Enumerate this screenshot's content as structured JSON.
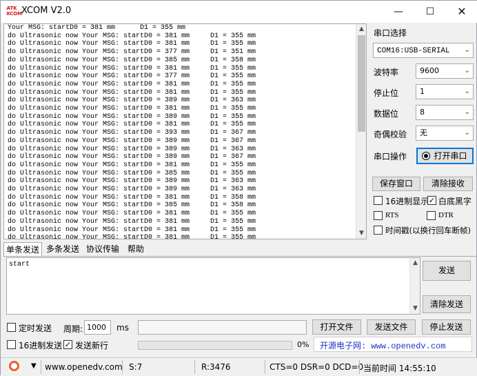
{
  "window": {
    "title": "XCOM V2.0",
    "logo_text": "ATK XCOM"
  },
  "receive": {
    "lines": [
      "Your MSG: startD0 = 381 mm      D1 = 355 mm",
      "do Ultrasonic now Your MSG: startD0 = 381 mm     D1 = 355 mm",
      "do Ultrasonic now Your MSG: startD0 = 381 mm     D1 = 355 mm",
      "do Ultrasonic now Your MSG: startD0 = 377 mm     D1 = 351 mm",
      "do Ultrasonic now Your MSG: startD0 = 385 mm     D1 = 358 mm",
      "do Ultrasonic now Your MSG: startD0 = 381 mm     D1 = 355 mm",
      "do Ultrasonic now Your MSG: startD0 = 377 mm     D1 = 355 mm",
      "do Ultrasonic now Your MSG: startD0 = 381 mm     D1 = 355 mm",
      "do Ultrasonic now Your MSG: startD0 = 381 mm     D1 = 355 mm",
      "do Ultrasonic now Your MSG: startD0 = 389 mm     D1 = 363 mm",
      "do Ultrasonic now Your MSG: startD0 = 381 mm     D1 = 355 mm",
      "do Ultrasonic now Your MSG: startD0 = 389 mm     D1 = 355 mm",
      "do Ultrasonic now Your MSG: startD0 = 381 mm     D1 = 355 mm",
      "do Ultrasonic now Your MSG: startD0 = 393 mm     D1 = 367 mm",
      "do Ultrasonic now Your MSG: startD0 = 389 mm     D1 = 367 mm",
      "do Ultrasonic now Your MSG: startD0 = 389 mm     D1 = 363 mm",
      "do Ultrasonic now Your MSG: startD0 = 389 mm     D1 = 367 mm",
      "do Ultrasonic now Your MSG: startD0 = 381 mm     D1 = 355 mm",
      "do Ultrasonic now Your MSG: startD0 = 385 mm     D1 = 355 mm",
      "do Ultrasonic now Your MSG: startD0 = 389 mm     D1 = 363 mm",
      "do Ultrasonic now Your MSG: startD0 = 389 mm     D1 = 363 mm",
      "do Ultrasonic now Your MSG: startD0 = 381 mm     D1 = 358 mm",
      "do Ultrasonic now Your MSG: startD0 = 385 mm     D1 = 358 mm",
      "do Ultrasonic now Your MSG: startD0 = 381 mm     D1 = 355 mm",
      "do Ultrasonic now Your MSG: startD0 = 381 mm     D1 = 355 mm",
      "do Ultrasonic now Your MSG: startD0 = 381 mm     D1 = 355 mm",
      "do Ultrasonic now Your MSG: startD0 = 381 mm     D1 = 355 mm"
    ]
  },
  "panel": {
    "port_select_label": "串口选择",
    "port_value": "COM16:USB-SERIAL",
    "baud_label": "波特率",
    "baud_value": "9600",
    "stop_label": "停止位",
    "stop_value": "1",
    "data_label": "数据位",
    "data_value": "8",
    "parity_label": "奇偶校验",
    "parity_value": "无",
    "op_label": "串口操作",
    "open_button": "打开串口",
    "save_button": "保存窗口",
    "clear_recv_button": "清除接收",
    "hex_display_label": "16进制显示",
    "white_bg_label": "白底黑字",
    "rts_label": "RTS",
    "dtr_label": "DTR",
    "timestamp_label": "时间戳(以换行回车断帧)"
  },
  "tabs": [
    "单条发送",
    "多条发送",
    "协议传输",
    "帮助"
  ],
  "send": {
    "text": "start",
    "send_button": "发送",
    "clear_send_button": "清除发送",
    "timed_send_label": "定时发送",
    "period_label": "周期:",
    "period_value": "1000",
    "period_unit": "ms",
    "open_file_button": "打开文件",
    "send_file_button": "发送文件",
    "stop_send_button": "停止发送",
    "hex_send_label": "16进制发送",
    "newline_label": "发送新行",
    "progress": "0%",
    "site_text": "开源电子网: www.openedv.com"
  },
  "status": {
    "url": "www.openedv.com",
    "sent": "S:7",
    "received": "R:3476",
    "lines": "CTS=0 DSR=0 DCD=0",
    "time": "当前时间 14:55:10"
  },
  "colors": {
    "accent": "#0078d7",
    "site_text": "#1a32c8",
    "logo_red": "#d01010"
  }
}
